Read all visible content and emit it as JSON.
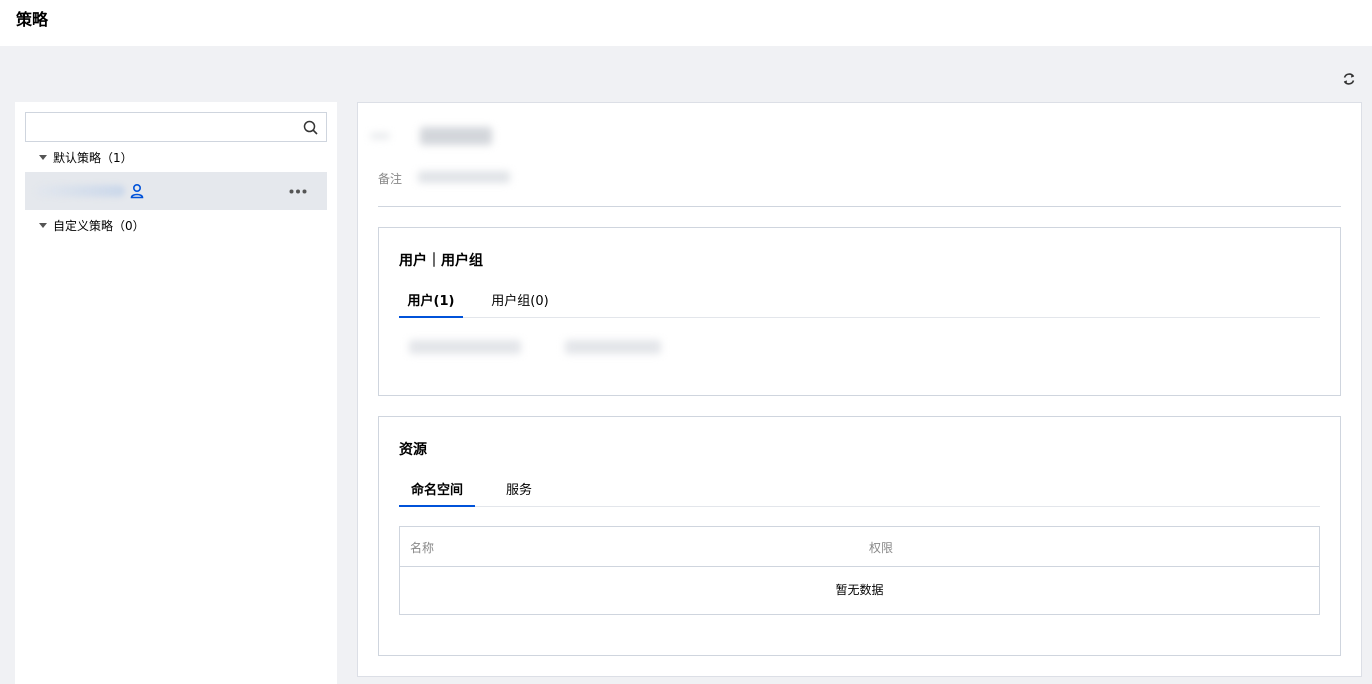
{
  "header": {
    "title": "策略"
  },
  "toolbar": {
    "refresh_icon": "refresh-icon"
  },
  "sidebar": {
    "search": {
      "placeholder": "",
      "value": ""
    },
    "groups": [
      {
        "label": "默认策略（1）",
        "expanded": true
      },
      {
        "label": "自定义策略（0）",
        "expanded": true
      }
    ]
  },
  "detail": {
    "remark_label": "备注",
    "users_card": {
      "title": "用户｜用户组",
      "tabs": [
        {
          "label": "用户(1)",
          "active": true
        },
        {
          "label": "用户组(0)",
          "active": false
        }
      ]
    },
    "resources_card": {
      "title": "资源",
      "tabs": [
        {
          "label": "命名空间",
          "active": true
        },
        {
          "label": "服务",
          "active": false
        }
      ],
      "table": {
        "columns": [
          "名称",
          "权限"
        ],
        "empty_text": "暂无数据"
      }
    }
  },
  "colors": {
    "accent": "#0052d9",
    "background": "#f0f1f4"
  }
}
